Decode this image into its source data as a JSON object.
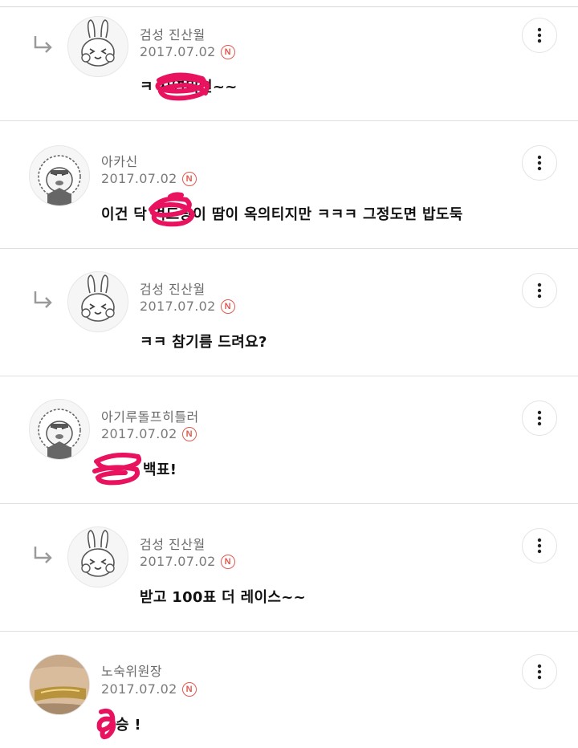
{
  "comments": [
    {
      "author": "검성 진산월",
      "date": "2017.07.02",
      "badge": "N",
      "text": "ㅋ   자연미인~~",
      "is_reply": true,
      "avatar": "bunny-avatar"
    },
    {
      "author": "아카신",
      "date": "2017.07.02",
      "badge": "N",
      "text": "이건 닥         겨드랑이 땀이 옥의티지만 ㅋㅋㅋ 그정도면 밥도둑",
      "is_reply": false,
      "avatar": "lion-avatar"
    },
    {
      "author": "검성 진산월",
      "date": "2017.07.02",
      "badge": "N",
      "text": "ㅋㅋ 참기름 드려요?",
      "is_reply": true,
      "avatar": "bunny-avatar"
    },
    {
      "author": "아기루돌프히틀러",
      "date": "2017.07.02",
      "badge": "N",
      "text": "백표!",
      "is_reply": false,
      "avatar": "lion-avatar"
    },
    {
      "author": "검성 진산월",
      "date": "2017.07.02",
      "badge": "N",
      "text": "받고 100표 더 레이스~~",
      "is_reply": true,
      "avatar": "bunny-avatar"
    },
    {
      "author": "노숙위원장",
      "date": "2017.07.02",
      "badge": "N",
      "text": "승 !",
      "is_reply": false,
      "avatar": "photo-avatar"
    }
  ],
  "colors": {
    "badge": "#e2584f",
    "scribble": "#e8125f",
    "divider": "#dedede"
  },
  "icons": {
    "more": "more-vertical-icon",
    "reply": "reply-arrow-icon"
  }
}
